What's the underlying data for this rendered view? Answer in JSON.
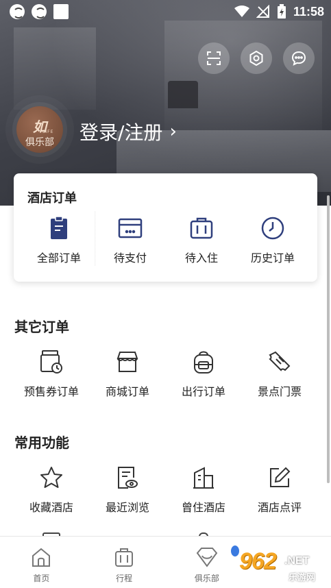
{
  "status_bar": {
    "time": "11:58"
  },
  "profile": {
    "avatar_logo": "如",
    "avatar_life": "LIFE",
    "avatar_label": "俱乐部",
    "login_text": "登录/注册",
    "login_chevron": "›"
  },
  "top_actions": [
    "scan-icon",
    "settings-icon",
    "message-icon"
  ],
  "hotel_orders": {
    "title": "酒店订单",
    "items": [
      {
        "label": "全部订单",
        "icon": "all-orders-icon"
      },
      {
        "label": "待支付",
        "icon": "pending-payment-icon"
      },
      {
        "label": "待入住",
        "icon": "pending-checkin-icon"
      },
      {
        "label": "历史订单",
        "icon": "history-orders-icon"
      }
    ]
  },
  "other_orders": {
    "title": "其它订单",
    "items": [
      {
        "label": "预售券订单",
        "icon": "presale-voucher-icon"
      },
      {
        "label": "商城订单",
        "icon": "mall-icon"
      },
      {
        "label": "出行订单",
        "icon": "travel-bag-icon"
      },
      {
        "label": "景点门票",
        "icon": "ticket-icon"
      }
    ]
  },
  "common_functions": {
    "title": "常用功能",
    "items": [
      {
        "label": "收藏酒店",
        "icon": "star-icon"
      },
      {
        "label": "最近浏览",
        "icon": "browse-history-icon"
      },
      {
        "label": "曾住酒店",
        "icon": "building-icon"
      },
      {
        "label": "酒店点评",
        "icon": "edit-review-icon"
      }
    ]
  },
  "bottom_nav": [
    {
      "label": "首页",
      "icon": "home-icon"
    },
    {
      "label": "行程",
      "icon": "trip-luggage-icon"
    },
    {
      "label": "俱乐部",
      "icon": "club-icon"
    },
    {
      "label": "",
      "icon": "profile-icon"
    }
  ],
  "watermark": {
    "num": "962",
    "net": ".NET",
    "cn": "乐游网"
  },
  "colors": {
    "accent_blue": "#2f3f7d",
    "icon_dark": "#333333",
    "nav_gray": "#777777"
  }
}
